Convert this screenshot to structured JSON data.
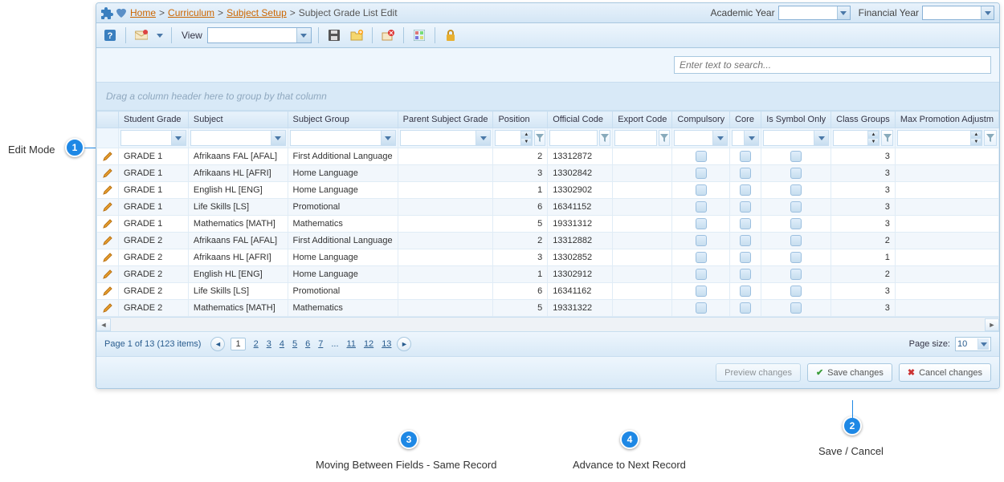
{
  "breadcrumb": {
    "home": "Home",
    "curriculum": "Curriculum",
    "subject_setup": "Subject Setup",
    "current": "Subject Grade List Edit",
    "academic_year_label": "Academic Year",
    "financial_year_label": "Financial Year"
  },
  "toolbar": {
    "view_label": "View"
  },
  "search": {
    "placeholder": "Enter text to search..."
  },
  "group_bar": {
    "hint": "Drag a column header here to group by that column"
  },
  "columns": {
    "student_grade": "Student Grade",
    "subject": "Subject",
    "subject_group": "Subject Group",
    "parent_subject_grade": "Parent Subject Grade",
    "position": "Position",
    "official_code": "Official Code",
    "export_code": "Export Code",
    "compulsory": "Compulsory",
    "core": "Core",
    "is_symbol_only": "Is Symbol Only",
    "class_groups": "Class Groups",
    "max_promotion": "Max Promotion Adjustm"
  },
  "rows": [
    {
      "grade": "GRADE 1",
      "subject": "Afrikaans FAL [AFAL]",
      "group": "First Additional Language",
      "parent": "",
      "pos": "2",
      "code": "13312872",
      "export": "",
      "class_groups": "3"
    },
    {
      "grade": "GRADE 1",
      "subject": "Afrikaans HL [AFRI]",
      "group": "Home Language",
      "parent": "",
      "pos": "3",
      "code": "13302842",
      "export": "",
      "class_groups": "3"
    },
    {
      "grade": "GRADE 1",
      "subject": "English HL [ENG]",
      "group": "Home Language",
      "parent": "",
      "pos": "1",
      "code": "13302902",
      "export": "",
      "class_groups": "3"
    },
    {
      "grade": "GRADE 1",
      "subject": "Life Skills [LS]",
      "group": "Promotional",
      "parent": "",
      "pos": "6",
      "code": "16341152",
      "export": "",
      "class_groups": "3"
    },
    {
      "grade": "GRADE 1",
      "subject": "Mathematics [MATH]",
      "group": "Mathematics",
      "parent": "",
      "pos": "5",
      "code": "19331312",
      "export": "",
      "class_groups": "3"
    },
    {
      "grade": "GRADE 2",
      "subject": "Afrikaans FAL [AFAL]",
      "group": "First Additional Language",
      "parent": "",
      "pos": "2",
      "code": "13312882",
      "export": "",
      "class_groups": "2"
    },
    {
      "grade": "GRADE 2",
      "subject": "Afrikaans HL [AFRI]",
      "group": "Home Language",
      "parent": "",
      "pos": "3",
      "code": "13302852",
      "export": "",
      "class_groups": "1"
    },
    {
      "grade": "GRADE 2",
      "subject": "English HL [ENG]",
      "group": "Home Language",
      "parent": "",
      "pos": "1",
      "code": "13302912",
      "export": "",
      "class_groups": "2"
    },
    {
      "grade": "GRADE 2",
      "subject": "Life Skills [LS]",
      "group": "Promotional",
      "parent": "",
      "pos": "6",
      "code": "16341162",
      "export": "",
      "class_groups": "3"
    },
    {
      "grade": "GRADE 2",
      "subject": "Mathematics [MATH]",
      "group": "Mathematics",
      "parent": "",
      "pos": "5",
      "code": "19331322",
      "export": "",
      "class_groups": "3"
    }
  ],
  "pager": {
    "info": "Page 1 of 13 (123 items)",
    "pages": [
      "1",
      "2",
      "3",
      "4",
      "5",
      "6",
      "7",
      "...",
      "11",
      "12",
      "13"
    ],
    "current": "1",
    "size_label": "Page size:",
    "size_value": "10"
  },
  "actions": {
    "preview": "Preview changes",
    "save": "Save changes",
    "cancel": "Cancel changes"
  },
  "callouts": {
    "c1": {
      "num": "1",
      "label": "Edit Mode"
    },
    "c2": {
      "num": "2",
      "label": "Save / Cancel"
    },
    "c3": {
      "num": "3",
      "label": "Moving Between Fields - Same Record"
    },
    "c4": {
      "num": "4",
      "label": "Advance to Next Record"
    }
  }
}
